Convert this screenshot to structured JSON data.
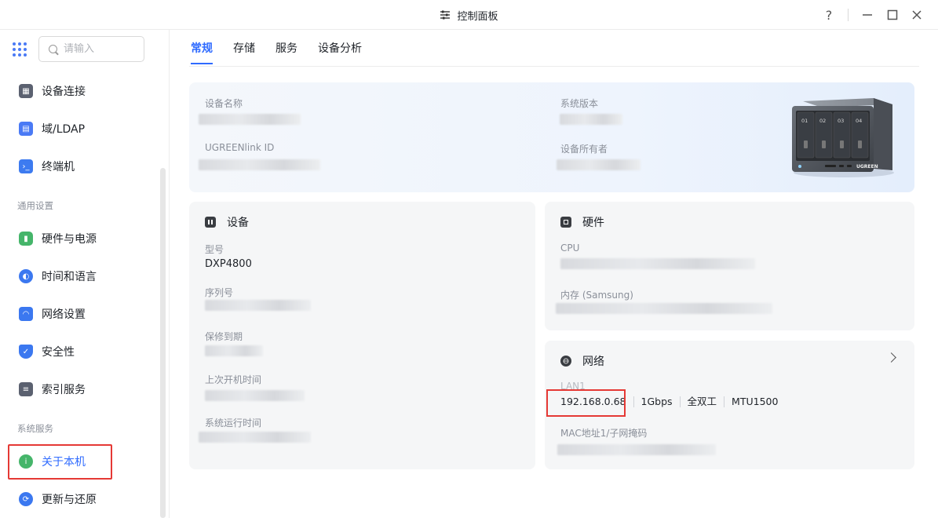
{
  "window": {
    "title": "控制面板",
    "help": "?",
    "minimize": "—",
    "maximize": "☐",
    "close": "✕"
  },
  "sidebar": {
    "search_placeholder": "请输入",
    "items": [
      {
        "label": "设备连接",
        "icon": "device-link-icon",
        "color": "#5b6170"
      },
      {
        "label": "域/LDAP",
        "icon": "domain-icon",
        "color": "#4a7af5"
      },
      {
        "label": "终端机",
        "icon": "terminal-icon",
        "color": "#3d7bf0"
      },
      {
        "label": "硬件与电源",
        "icon": "battery-icon",
        "color": "#45b56a"
      },
      {
        "label": "时间和语言",
        "icon": "globe-icon",
        "color": "#3b78f0"
      },
      {
        "label": "网络设置",
        "icon": "wifi-icon",
        "color": "#3b78f0"
      },
      {
        "label": "安全性",
        "icon": "shield-icon",
        "color": "#3b78f0"
      },
      {
        "label": "索引服务",
        "icon": "index-icon",
        "color": "#5b6170"
      },
      {
        "label": "关于本机",
        "icon": "info-icon",
        "color": "#45b56a"
      },
      {
        "label": "更新与还原",
        "icon": "refresh-icon",
        "color": "#3b78f0"
      }
    ],
    "sections": [
      "通用设置",
      "系统服务"
    ]
  },
  "tabs": [
    "常规",
    "存储",
    "服务",
    "设备分析"
  ],
  "hero": {
    "device_name_label": "设备名称",
    "ugreenlink_label": "UGREENlink ID",
    "system_version_label": "系统版本",
    "owner_label": "设备所有者"
  },
  "device_card": {
    "title": "设备",
    "model_label": "型号",
    "model_value": "DXP4800",
    "serial_label": "序列号",
    "warranty_label": "保修到期",
    "last_boot_label": "上次开机时间",
    "uptime_label": "系统运行时间"
  },
  "hardware_card": {
    "title": "硬件",
    "cpu_label": "CPU",
    "memory_label": "内存 (Samsung)"
  },
  "network_card": {
    "title": "网络",
    "lan_label": "LAN1",
    "ip": "192.168.0.68",
    "speed": "1Gbps",
    "duplex": "全双工",
    "mtu": "MTU1500",
    "mac_label": "MAC地址1/子网掩码"
  },
  "nas_bays": [
    "01",
    "02",
    "03",
    "04"
  ],
  "nas_brand": "UGREEN"
}
